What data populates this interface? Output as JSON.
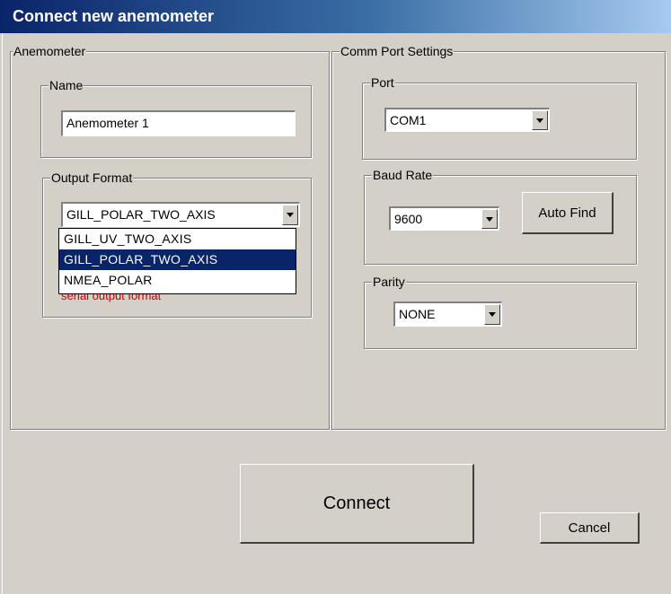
{
  "window": {
    "title": "Connect new anemometer"
  },
  "anemometer": {
    "group_label": "Anemometer",
    "name": {
      "label": "Name",
      "value": "Anemometer 1"
    },
    "output_format": {
      "label": "Output Format",
      "selected": "GILL_POLAR_TWO_AXIS",
      "options": [
        "GILL_UV_TWO_AXIS",
        "GILL_POLAR_TWO_AXIS",
        "NMEA_POLAR"
      ],
      "highlighted_index": 1,
      "hint": "serial output format"
    }
  },
  "comm": {
    "group_label": "Comm Port Settings",
    "port": {
      "label": "Port",
      "selected": "COM1"
    },
    "baud": {
      "label": "Baud Rate",
      "selected": "9600",
      "auto_find_label": "Auto Find"
    },
    "parity": {
      "label": "Parity",
      "selected": "NONE"
    }
  },
  "actions": {
    "connect_label": "Connect",
    "cancel_label": "Cancel"
  },
  "colors": {
    "title_bar": "#0a246a",
    "selection": "#0a246a",
    "hint_text": "#cc0000",
    "dialog_bg": "#d4d0c8"
  }
}
